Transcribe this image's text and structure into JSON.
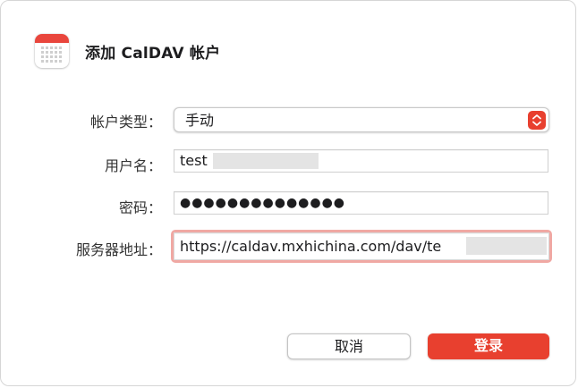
{
  "dialog": {
    "title": "添加 CalDAV 帐户",
    "icon": "calendar-icon"
  },
  "form": {
    "account_type": {
      "label": "帐户类型：",
      "value": "手动"
    },
    "username": {
      "label": "用户名：",
      "value": "test"
    },
    "password": {
      "label": "密码：",
      "value": "●●●●●●●●●●●●●●"
    },
    "server": {
      "label": "服务器地址：",
      "value": "https://caldav.mxhichina.com/dav/te"
    }
  },
  "buttons": {
    "cancel": "取消",
    "login": "登录"
  },
  "colors": {
    "accent": "#e8402f",
    "focus_ring": "#f0a8a3",
    "calendar_band": "#e9463d"
  }
}
